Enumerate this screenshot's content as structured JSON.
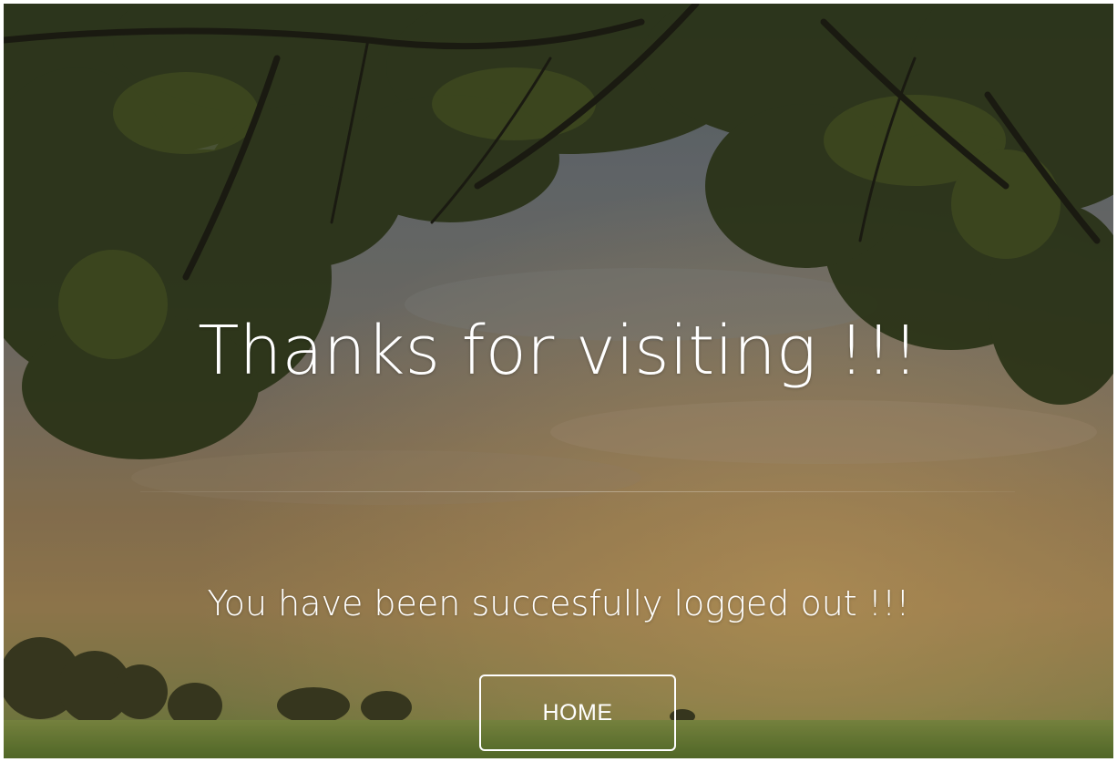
{
  "hero": {
    "headline": "Thanks for visiting !!!",
    "message": "You have been succesfully logged out !!!",
    "home_button_label": "HOME"
  },
  "background": {
    "description_icon": "tree-landscape-photo",
    "sky_color": "#6f7679",
    "sunset_color": "#a78a57",
    "foliage_color": "#2f3a18",
    "grass_color": "#6f8a3b"
  },
  "colors": {
    "text": "#ffffff",
    "button_border": "#ffffff"
  }
}
